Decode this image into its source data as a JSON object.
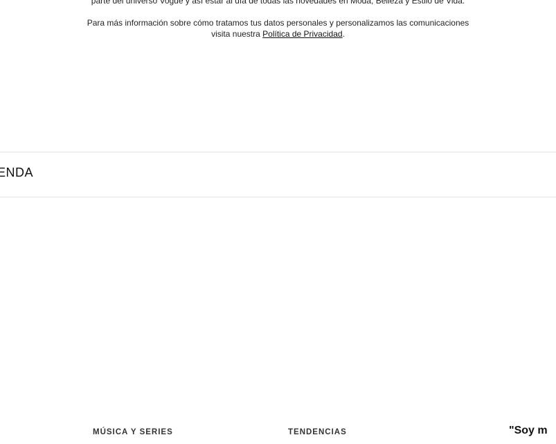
{
  "consent": {
    "line1": "parte del universo Vogue y así estar al día de todas las novedades en Moda, Belleza y Estilo de Vida.",
    "line2": "Para más información sobre cómo tratamos tus datos personales y personalizamos las comunicaciones",
    "line3_prefix": "visita nuestra ",
    "privacy_link": "Política de Privacidad",
    "line3_suffix": "."
  },
  "section": {
    "heading": "ENDA"
  },
  "footer": {
    "categories": [
      {
        "label": "MÚSICA Y SERIES"
      },
      {
        "label": "TENDENCIAS"
      }
    ],
    "quote_fragment": "\"Soy m"
  }
}
